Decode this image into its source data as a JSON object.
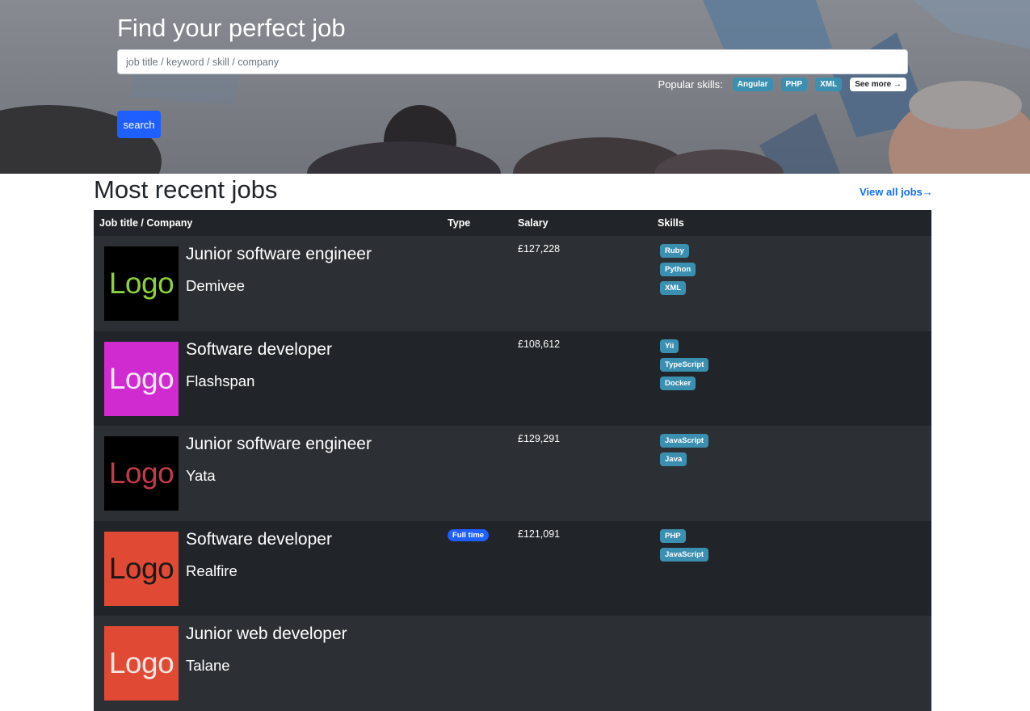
{
  "hero": {
    "title": "Find your perfect job",
    "search_placeholder": "job title / keyword / skill / company",
    "popular_label": "Popular skills:",
    "popular_skills": [
      "Angular",
      "PHP",
      "XML"
    ],
    "see_more": "See more →",
    "search_button": "search"
  },
  "recent": {
    "title": "Most recent jobs",
    "view_all": "View all jobs→",
    "columns": {
      "title": "Job title / Company",
      "type": "Type",
      "salary": "Salary",
      "skills": "Skills"
    },
    "jobs": [
      {
        "logo_text": "Logo",
        "logo_bg": "#000000",
        "logo_color": "#8bd13a",
        "title": "Junior software engineer",
        "company": "Demivee",
        "type": "",
        "salary": "£127,228",
        "skills": [
          "Ruby",
          "Python",
          "XML"
        ]
      },
      {
        "logo_text": "Logo",
        "logo_bg": "#d02bd0",
        "logo_color": "#f5e9f5",
        "title": "Software developer",
        "company": "Flashspan",
        "type": "",
        "salary": "£108,612",
        "skills": [
          "Yii",
          "TypeScript",
          "Docker"
        ]
      },
      {
        "logo_text": "Logo",
        "logo_bg": "#000000",
        "logo_color": "#c23a4a",
        "title": "Junior software engineer",
        "company": "Yata",
        "type": "",
        "salary": "£129,291",
        "skills": [
          "JavaScript",
          "Java"
        ]
      },
      {
        "logo_text": "Logo",
        "logo_bg": "#e04a35",
        "logo_color": "#1a1a1a",
        "title": "Software developer",
        "company": "Realfire",
        "type": "Full time",
        "salary": "£121,091",
        "skills": [
          "PHP",
          "JavaScript"
        ]
      },
      {
        "logo_text": "Logo",
        "logo_bg": "#e04a35",
        "logo_color": "#f3e6e3",
        "title": "Junior web developer",
        "company": "Talane",
        "type": "",
        "salary": "",
        "skills": []
      }
    ]
  },
  "colors": {
    "primary": "#1f5fff",
    "link": "#0d6efd",
    "skill_badge": "#3b8fb0",
    "table_dark": "#212529",
    "table_stripe": "#2c3034"
  }
}
